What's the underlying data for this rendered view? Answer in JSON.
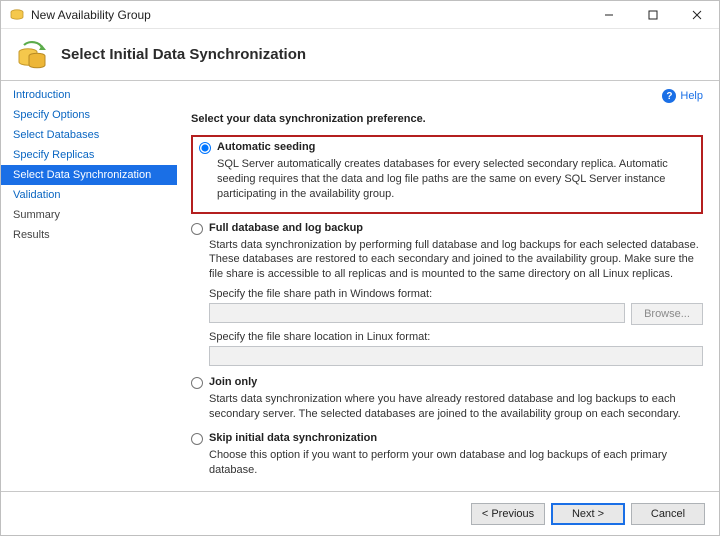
{
  "window": {
    "title": "New Availability Group"
  },
  "header": {
    "title": "Select Initial Data Synchronization"
  },
  "help": {
    "label": "Help"
  },
  "sidebar": {
    "items": [
      {
        "label": "Introduction"
      },
      {
        "label": "Specify Options"
      },
      {
        "label": "Select Databases"
      },
      {
        "label": "Specify Replicas"
      },
      {
        "label": "Select Data Synchronization"
      },
      {
        "label": "Validation"
      },
      {
        "label": "Summary"
      },
      {
        "label": "Results"
      }
    ]
  },
  "content": {
    "intro": "Select your data synchronization preference.",
    "opt_auto": {
      "label": "Automatic seeding",
      "desc": "SQL Server automatically creates databases for every selected secondary replica. Automatic seeding requires that the data and log file paths are the same on every SQL Server instance participating in the availability group."
    },
    "opt_full": {
      "label": "Full database and log backup",
      "desc": "Starts data synchronization by performing full database and log backups for each selected database. These databases are restored to each secondary and joined to the availability group. Make sure the file share is accessible to all replicas and is mounted to the same directory on all Linux replicas.",
      "share_win_label": "Specify the file share path in Windows format:",
      "share_win_value": "",
      "browse_label": "Browse...",
      "share_lin_label": "Specify the file share location in Linux format:",
      "share_lin_value": ""
    },
    "opt_join": {
      "label": "Join only",
      "desc": "Starts data synchronization where you have already restored database and log backups to each secondary server. The selected databases are joined to the availability group on each secondary."
    },
    "opt_skip": {
      "label": "Skip initial data synchronization",
      "desc": "Choose this option if you want to perform your own database and log backups of each primary database."
    }
  },
  "footer": {
    "previous": "< Previous",
    "next": "Next >",
    "cancel": "Cancel"
  }
}
